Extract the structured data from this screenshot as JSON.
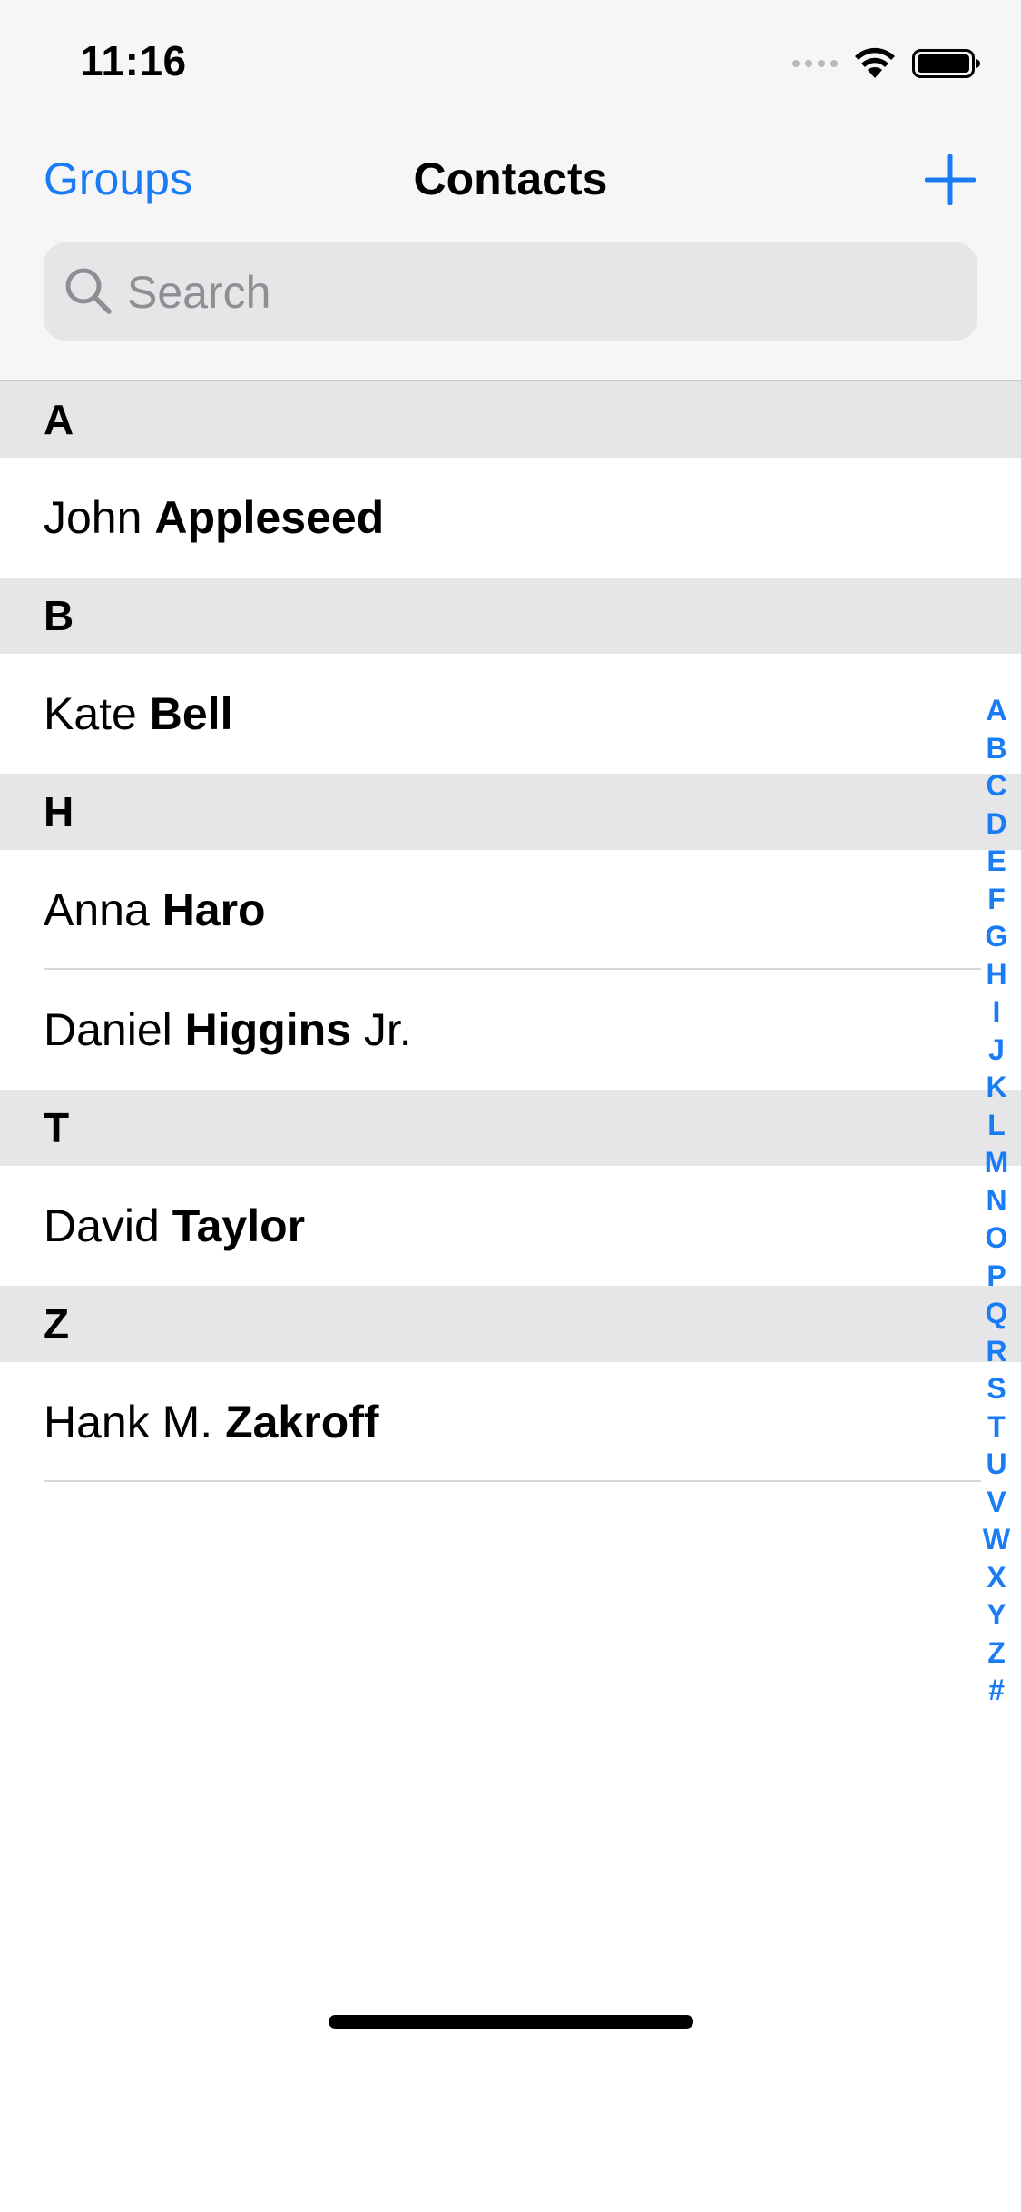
{
  "status": {
    "time": "11:16"
  },
  "nav": {
    "left": "Groups",
    "title": "Contacts",
    "add_icon": "plus-icon"
  },
  "search": {
    "placeholder": "Search",
    "value": ""
  },
  "sections": [
    {
      "letter": "A",
      "contacts": [
        {
          "first": "John",
          "last": "Appleseed",
          "suffix": ""
        }
      ]
    },
    {
      "letter": "B",
      "contacts": [
        {
          "first": "Kate",
          "last": "Bell",
          "suffix": ""
        }
      ]
    },
    {
      "letter": "H",
      "contacts": [
        {
          "first": "Anna",
          "last": "Haro",
          "suffix": ""
        },
        {
          "first": "Daniel",
          "last": "Higgins",
          "suffix": "Jr."
        }
      ]
    },
    {
      "letter": "T",
      "contacts": [
        {
          "first": "David",
          "last": "Taylor",
          "suffix": ""
        }
      ]
    },
    {
      "letter": "Z",
      "contacts": [
        {
          "first": "Hank M.",
          "last": "Zakroff",
          "suffix": ""
        }
      ]
    }
  ],
  "index": [
    "A",
    "B",
    "C",
    "D",
    "E",
    "F",
    "G",
    "H",
    "I",
    "J",
    "K",
    "L",
    "M",
    "N",
    "O",
    "P",
    "Q",
    "R",
    "S",
    "T",
    "U",
    "V",
    "W",
    "X",
    "Y",
    "Z",
    "#"
  ],
  "colors": {
    "accent": "#1a7cf5",
    "section_bg": "#e6e6e8",
    "header_bg": "#f6f6f6"
  }
}
